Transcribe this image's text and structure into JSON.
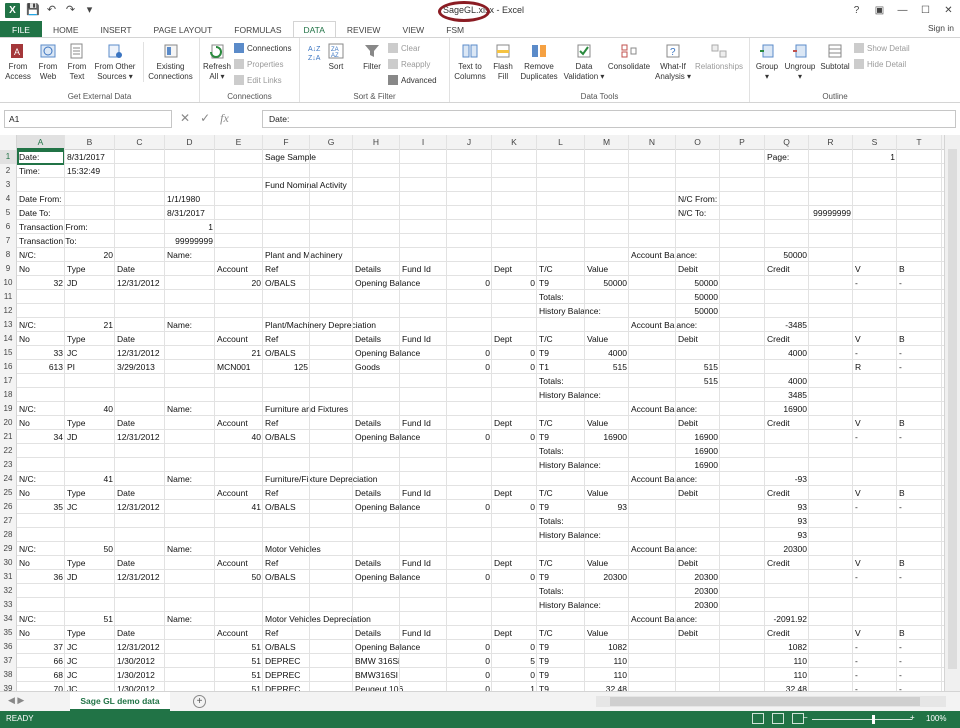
{
  "window": {
    "file": "SageGL.xlsx",
    "app": "Excel",
    "help": "?",
    "restore_ribbon": "▣",
    "minimize": "—",
    "maximize": "☐",
    "close": "✕"
  },
  "qat": {
    "save": "💾",
    "undo": "↶",
    "redo": "↷",
    "customize": "▾"
  },
  "tabs": [
    "FILE",
    "HOME",
    "INSERT",
    "PAGE LAYOUT",
    "FORMULAS",
    "DATA",
    "REVIEW",
    "VIEW",
    "FSM"
  ],
  "active_tab": "DATA",
  "signin": "Sign in",
  "ribbon": {
    "get_external": {
      "label": "Get External Data",
      "buttons": [
        [
          "From",
          "Access"
        ],
        [
          "From",
          "Web"
        ],
        [
          "From",
          "Text"
        ],
        [
          "From Other",
          "Sources ▾"
        ]
      ],
      "existing": [
        "Existing",
        "Connections"
      ]
    },
    "connections": {
      "label": "Connections",
      "refresh": [
        "Refresh",
        "All ▾"
      ],
      "small": [
        "Connections",
        "Properties",
        "Edit Links"
      ]
    },
    "sort_filter": {
      "label": "Sort & Filter",
      "sort": "Sort",
      "filter": "Filter",
      "small": [
        "Clear",
        "Reapply",
        "Advanced"
      ]
    },
    "data_tools": {
      "label": "Data Tools",
      "buttons": [
        [
          "Text to",
          "Columns"
        ],
        [
          "Flash",
          "Fill"
        ],
        [
          "Remove",
          "Duplicates"
        ],
        [
          "Data",
          "Validation ▾"
        ],
        [
          "Consolidate",
          ""
        ],
        [
          "What-If",
          "Analysis ▾"
        ],
        [
          "Relationships",
          ""
        ]
      ]
    },
    "outline": {
      "label": "Outline",
      "buttons": [
        [
          "Group",
          "▾"
        ],
        [
          "Ungroup",
          "▾"
        ],
        [
          "Subtotal",
          ""
        ]
      ],
      "small": [
        "Show Detail",
        "Hide Detail"
      ]
    }
  },
  "namebox": "A1",
  "formula": "Date:",
  "fx": "fx",
  "columns": [
    "A",
    "B",
    "C",
    "D",
    "E",
    "F",
    "G",
    "H",
    "I",
    "J",
    "K",
    "L",
    "M",
    "N",
    "O",
    "P",
    "Q",
    "R",
    "S",
    "T"
  ],
  "rows": [
    {
      "n": "1",
      "c": {
        "A": "Date:",
        "B": "8/31/2017",
        "F": "Sage Sample",
        "Q": "Page:",
        "S": "1"
      }
    },
    {
      "n": "2",
      "c": {
        "A": "Time:",
        "B": "15:32:49"
      }
    },
    {
      "n": "3",
      "c": {
        "F": "Fund Nominal Activity"
      }
    },
    {
      "n": "4",
      "c": {
        "A": "Date From:",
        "D": "1/1/1980",
        "O": "N/C From:"
      }
    },
    {
      "n": "5",
      "c": {
        "A": "Date To:",
        "D": "8/31/2017",
        "O": "N/C To:",
        "R": "99999999"
      }
    },
    {
      "n": "6",
      "c": {
        "A": "Transaction From:",
        "D": "1"
      }
    },
    {
      "n": "7",
      "c": {
        "A": "Transaction To:",
        "D": "99999999"
      }
    },
    {
      "n": "8",
      "c": {
        "A": "N/C:",
        "B": "20",
        "D": "Name:",
        "F": "Plant and Machinery",
        "N": "Account Balance:",
        "Q": "50000"
      }
    },
    {
      "n": "9",
      "c": {
        "A": "No",
        "B": "Type",
        "C": "Date",
        "E": "Account",
        "F": "Ref",
        "H": "Details",
        "I": "Fund Id",
        "K": "Dept",
        "L": "T/C",
        "M": "Value",
        "O": "Debit",
        "Q": "Credit",
        "S": "V",
        "T": "B"
      }
    },
    {
      "n": "10",
      "c": {
        "A": "32",
        "B": "JD",
        "C": "12/31/2012",
        "E": "20",
        "F": "O/BALS",
        "H": "Opening Balance",
        "J": "0",
        "K": "0",
        "L": "T9",
        "M": "50000",
        "O": "50000",
        "S": "-",
        "T": "-"
      }
    },
    {
      "n": "11",
      "c": {
        "L": "Totals:",
        "O": "50000"
      }
    },
    {
      "n": "12",
      "c": {
        "L": "History Balance:",
        "O": "50000"
      }
    },
    {
      "n": "13",
      "c": {
        "A": "N/C:",
        "B": "21",
        "D": "Name:",
        "F": "Plant/Machinery Depreciation",
        "N": "Account Balance:",
        "Q": "-3485"
      }
    },
    {
      "n": "14",
      "c": {
        "A": "No",
        "B": "Type",
        "C": "Date",
        "E": "Account",
        "F": "Ref",
        "H": "Details",
        "I": "Fund Id",
        "K": "Dept",
        "L": "T/C",
        "M": "Value",
        "O": "Debit",
        "Q": "Credit",
        "S": "V",
        "T": "B"
      }
    },
    {
      "n": "15",
      "c": {
        "A": "33",
        "B": "JC",
        "C": "12/31/2012",
        "E": "21",
        "F": "O/BALS",
        "H": "Opening Balance",
        "J": "0",
        "K": "0",
        "L": "T9",
        "M": "4000",
        "Q": "4000",
        "S": "-",
        "T": "-"
      }
    },
    {
      "n": "16",
      "c": {
        "A": "613",
        "B": "PI",
        "C": "3/29/2013",
        "E": "MCN001",
        "F": "125",
        "H": "Goods",
        "J": "0",
        "K": "0",
        "L": "T1",
        "M": "515",
        "O": "515",
        "S": "R",
        "T": "-"
      }
    },
    {
      "n": "17",
      "c": {
        "L": "Totals:",
        "O": "515",
        "Q": "4000"
      }
    },
    {
      "n": "18",
      "c": {
        "L": "History Balance:",
        "Q": "3485"
      }
    },
    {
      "n": "19",
      "c": {
        "A": "N/C:",
        "B": "40",
        "D": "Name:",
        "F": "Furniture and Fixtures",
        "N": "Account Balance:",
        "Q": "16900"
      }
    },
    {
      "n": "20",
      "c": {
        "A": "No",
        "B": "Type",
        "C": "Date",
        "E": "Account",
        "F": "Ref",
        "H": "Details",
        "I": "Fund Id",
        "K": "Dept",
        "L": "T/C",
        "M": "Value",
        "O": "Debit",
        "Q": "Credit",
        "S": "V",
        "T": "B"
      }
    },
    {
      "n": "21",
      "c": {
        "A": "34",
        "B": "JD",
        "C": "12/31/2012",
        "E": "40",
        "F": "O/BALS",
        "H": "Opening Balance",
        "J": "0",
        "K": "0",
        "L": "T9",
        "M": "16900",
        "O": "16900",
        "S": "-",
        "T": "-"
      }
    },
    {
      "n": "22",
      "c": {
        "L": "Totals:",
        "O": "16900"
      }
    },
    {
      "n": "23",
      "c": {
        "L": "History Balance:",
        "O": "16900"
      }
    },
    {
      "n": "24",
      "c": {
        "A": "N/C:",
        "B": "41",
        "D": "Name:",
        "F": "Furniture/Fixture Depreciation",
        "N": "Account Balance:",
        "Q": "-93"
      }
    },
    {
      "n": "25",
      "c": {
        "A": "No",
        "B": "Type",
        "C": "Date",
        "E": "Account",
        "F": "Ref",
        "H": "Details",
        "I": "Fund Id",
        "K": "Dept",
        "L": "T/C",
        "M": "Value",
        "O": "Debit",
        "Q": "Credit",
        "S": "V",
        "T": "B"
      }
    },
    {
      "n": "26",
      "c": {
        "A": "35",
        "B": "JC",
        "C": "12/31/2012",
        "E": "41",
        "F": "O/BALS",
        "H": "Opening Balance",
        "J": "0",
        "K": "0",
        "L": "T9",
        "M": "93",
        "Q": "93",
        "S": "-",
        "T": "-"
      }
    },
    {
      "n": "27",
      "c": {
        "L": "Totals:",
        "Q": "93"
      }
    },
    {
      "n": "28",
      "c": {
        "L": "History Balance:",
        "Q": "93"
      }
    },
    {
      "n": "29",
      "c": {
        "A": "N/C:",
        "B": "50",
        "D": "Name:",
        "F": "Motor Vehicles",
        "N": "Account Balance:",
        "Q": "20300"
      }
    },
    {
      "n": "30",
      "c": {
        "A": "No",
        "B": "Type",
        "C": "Date",
        "E": "Account",
        "F": "Ref",
        "H": "Details",
        "I": "Fund Id",
        "K": "Dept",
        "L": "T/C",
        "M": "Value",
        "O": "Debit",
        "Q": "Credit",
        "S": "V",
        "T": "B"
      }
    },
    {
      "n": "31",
      "c": {
        "A": "36",
        "B": "JD",
        "C": "12/31/2012",
        "E": "50",
        "F": "O/BALS",
        "H": "Opening Balance",
        "J": "0",
        "K": "0",
        "L": "T9",
        "M": "20300",
        "O": "20300",
        "S": "-",
        "T": "-"
      }
    },
    {
      "n": "32",
      "c": {
        "L": "Totals:",
        "O": "20300"
      }
    },
    {
      "n": "33",
      "c": {
        "L": "History Balance:",
        "O": "20300"
      }
    },
    {
      "n": "34",
      "c": {
        "A": "N/C:",
        "B": "51",
        "D": "Name:",
        "F": "Motor Vehicles Depreciation",
        "N": "Account Balance:",
        "Q": "-2091.92"
      }
    },
    {
      "n": "35",
      "c": {
        "A": "No",
        "B": "Type",
        "C": "Date",
        "E": "Account",
        "F": "Ref",
        "H": "Details",
        "I": "Fund Id",
        "K": "Dept",
        "L": "T/C",
        "M": "Value",
        "O": "Debit",
        "Q": "Credit",
        "S": "V",
        "T": "B"
      }
    },
    {
      "n": "36",
      "c": {
        "A": "37",
        "B": "JC",
        "C": "12/31/2012",
        "E": "51",
        "F": "O/BALS",
        "H": "Opening Balance",
        "J": "0",
        "K": "0",
        "L": "T9",
        "M": "1082",
        "Q": "1082",
        "S": "-",
        "T": "-"
      }
    },
    {
      "n": "37",
      "c": {
        "A": "66",
        "B": "JC",
        "C": "1/30/2012",
        "E": "51",
        "F": "DEPREC",
        "H": "BMW 316Si",
        "J": "0",
        "K": "5",
        "L": "T9",
        "M": "110",
        "Q": "110",
        "S": "-",
        "T": "-"
      }
    },
    {
      "n": "38",
      "c": {
        "A": "68",
        "B": "JC",
        "C": "1/30/2012",
        "E": "51",
        "F": "DEPREC",
        "H": "BMW316SI",
        "J": "0",
        "K": "0",
        "L": "T9",
        "M": "110",
        "Q": "110",
        "S": "-",
        "T": "-"
      }
    },
    {
      "n": "39",
      "c": {
        "A": "70",
        "B": "JC",
        "C": "1/30/2012",
        "E": "51",
        "F": "DEPREC",
        "H": "Peugeut 106",
        "J": "0",
        "K": "1",
        "L": "T9",
        "M": "32.48",
        "Q": "32.48",
        "S": "-",
        "T": "-"
      }
    }
  ],
  "sheet_tab": "Sage GL demo data",
  "add_sheet": "+",
  "sheet_nav": "◀ ▶",
  "status": {
    "ready": "READY",
    "zoom": "100%",
    "minus": "−",
    "plus": "+"
  }
}
